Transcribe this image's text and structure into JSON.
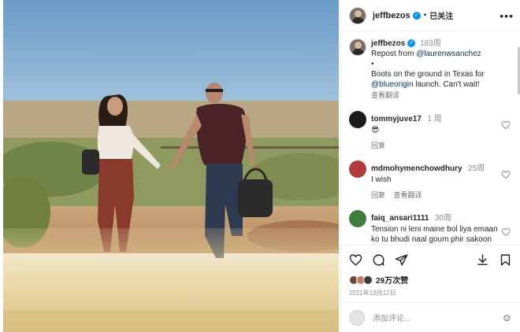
{
  "post": {
    "username": "jeffbezos",
    "follow_label": "已关注",
    "more_label": "•••",
    "separator": "•"
  },
  "caption": {
    "username": "jeffbezos",
    "age": "183周",
    "line1": "Repost from ",
    "mention1": "@laurenwsanchez",
    "bullet": "•",
    "line2": "Boots on the ground in Texas for ",
    "mention2": "@blueorigin",
    "line3": " launch. Can't wait!",
    "see_translation": "查看翻译"
  },
  "comments": [
    {
      "username": "tommyjuve17",
      "age": "1 周",
      "text": "😎",
      "reply_label": "回复",
      "translate_label": "",
      "avatar_color": "#1c1c1c"
    },
    {
      "username": "mdmohymenchowdhury",
      "age": "25周",
      "text": "I wish",
      "reply_label": "回复",
      "translate_label": "查看翻译",
      "avatar_color": "#b23a3a"
    },
    {
      "username": "faiq_ansari1111",
      "age": "30周",
      "text": "Tension ni leni maine bol liya emaan ko tu bhudi naal goum phir sakoon naal",
      "reply_label": "",
      "translate_label": "",
      "avatar_color": "#3f7e3a"
    }
  ],
  "actions": {
    "likes_text": "29万次赞",
    "date": "2021年10月12日",
    "like_avatar_colors": [
      "#6b4a3a",
      "#c47a5a",
      "#3b3b3b"
    ]
  },
  "composer": {
    "placeholder": "添加评论..."
  },
  "colors": {
    "accent": "#0095f6",
    "link": "#00376b",
    "muted": "#8e8e8e"
  }
}
